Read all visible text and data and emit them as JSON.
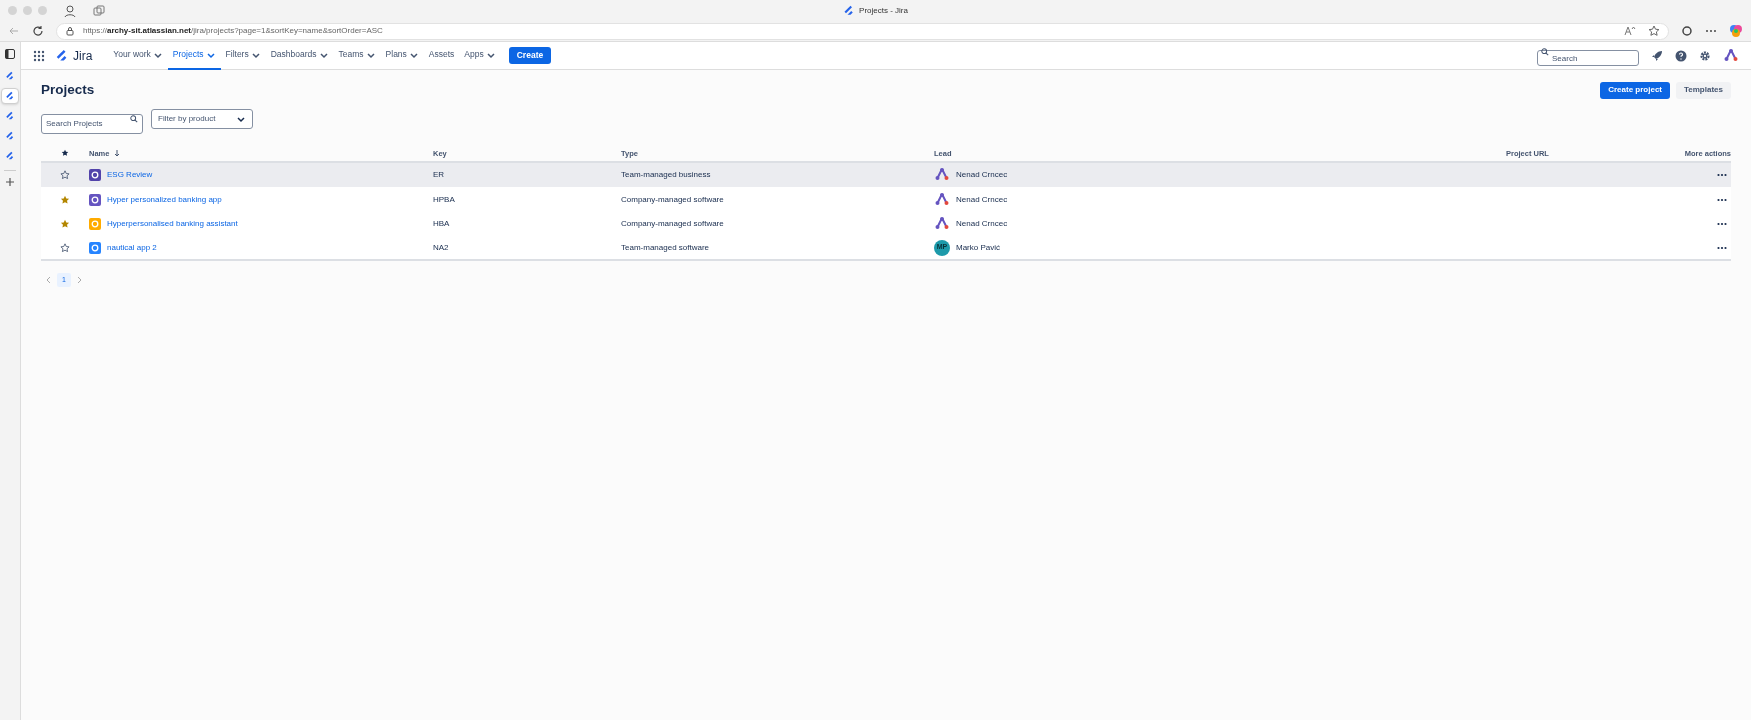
{
  "window": {
    "title": "Projects - Jira"
  },
  "address_bar": {
    "url": "https://**archy-sit.atlassian.net**/jira/projects?page=1&sortKey=name&sortOrder=ASC"
  },
  "browser_sidebar": {
    "tabs": [
      {
        "selected": false
      },
      {
        "selected": true
      },
      {
        "selected": false
      },
      {
        "selected": false
      },
      {
        "selected": false
      }
    ]
  },
  "nav": {
    "product": "Jira",
    "items": [
      {
        "label": "Your work",
        "dropdown": true,
        "selected": false
      },
      {
        "label": "Projects",
        "dropdown": true,
        "selected": true
      },
      {
        "label": "Filters",
        "dropdown": true,
        "selected": false
      },
      {
        "label": "Dashboards",
        "dropdown": true,
        "selected": false
      },
      {
        "label": "Teams",
        "dropdown": true,
        "selected": false
      },
      {
        "label": "Plans",
        "dropdown": true,
        "selected": false
      },
      {
        "label": "Assets",
        "dropdown": false,
        "selected": false
      },
      {
        "label": "Apps",
        "dropdown": true,
        "selected": false
      }
    ],
    "create": "Create",
    "search": {
      "placeholder": "Search"
    }
  },
  "page": {
    "title": "Projects",
    "buttons": [
      "Create project",
      "Templates"
    ],
    "search": {
      "placeholder": "Search Projects"
    },
    "filter": {
      "placeholder": "Filter by product"
    }
  },
  "table": {
    "columns": [
      "Name",
      "Key",
      "Type",
      "Lead",
      "Project URL",
      "More actions"
    ],
    "rows": [
      {
        "name": "ESG Review",
        "key": "ER",
        "type": "Team-managed business",
        "lead": "Nenad Crncec",
        "lead_avatar": {
          "kind": "logo"
        },
        "starred": false,
        "highlighted": true,
        "color": "#5243aa"
      },
      {
        "name": "Hyper personalized banking app",
        "key": "HPBA",
        "type": "Company-managed software",
        "lead": "Nenad Crncec",
        "lead_avatar": {
          "kind": "logo"
        },
        "starred": true,
        "highlighted": false,
        "color": "#6554c0"
      },
      {
        "name": "Hyperpersonalised banking assistant",
        "key": "HBA",
        "type": "Company-managed software",
        "lead": "Nenad Crncec",
        "lead_avatar": {
          "kind": "logo"
        },
        "starred": true,
        "highlighted": false,
        "color": "#ffab00"
      },
      {
        "name": "nautical app 2",
        "key": "NA2",
        "type": "Team-managed software",
        "lead": "Marko Pavić",
        "lead_avatar": {
          "kind": "initials",
          "initials": "MP"
        },
        "starred": false,
        "highlighted": false,
        "color": "#2684ff"
      }
    ]
  },
  "pagination": {
    "pages": [
      {
        "label": "1",
        "selected": true
      }
    ]
  }
}
